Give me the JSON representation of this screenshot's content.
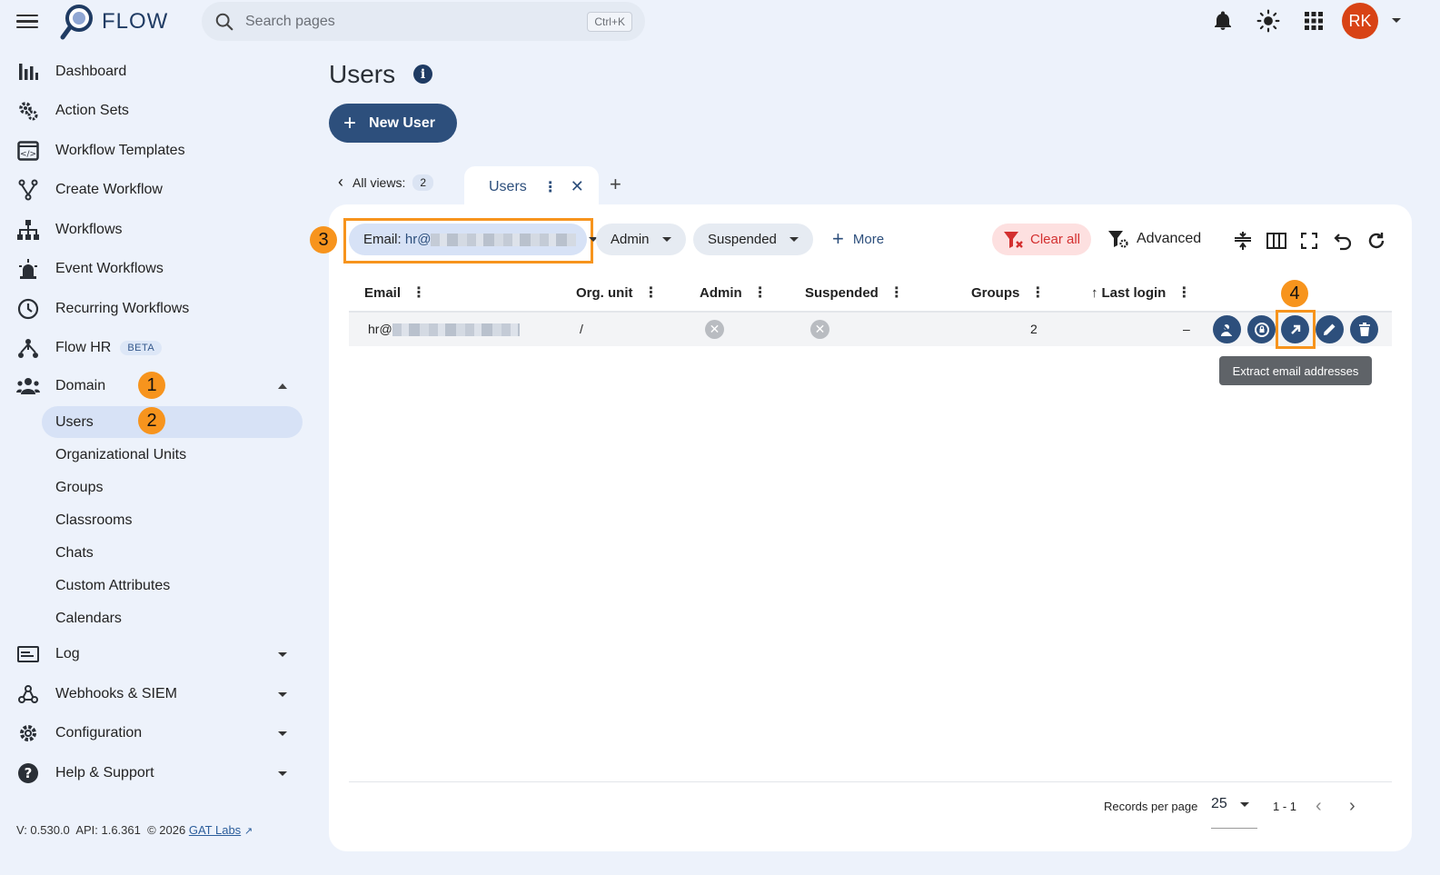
{
  "app": {
    "name": "FLOW"
  },
  "search": {
    "placeholder": "Search pages",
    "shortcut": "Ctrl+K"
  },
  "user": {
    "initials": "RK",
    "avatar_color": "#d84315"
  },
  "sidebar": {
    "items": [
      {
        "label": "Dashboard",
        "icon": "bar-chart-icon"
      },
      {
        "label": "Action Sets",
        "icon": "gears-icon"
      },
      {
        "label": "Workflow Templates",
        "icon": "template-icon"
      },
      {
        "label": "Create Workflow",
        "icon": "fork-icon"
      },
      {
        "label": "Workflows",
        "icon": "sitemap-icon"
      },
      {
        "label": "Event Workflows",
        "icon": "alarm-icon"
      },
      {
        "label": "Recurring Workflows",
        "icon": "clock-icon"
      },
      {
        "label": "Flow HR",
        "icon": "hr-icon",
        "badge": "BETA"
      },
      {
        "label": "Domain",
        "icon": "people-icon",
        "expanded": true
      }
    ],
    "domain_children": [
      "Users",
      "Organizational Units",
      "Groups",
      "Classrooms",
      "Chats",
      "Custom Attributes",
      "Calendars"
    ],
    "bottom_items": [
      {
        "label": "Log",
        "icon": "log-icon"
      },
      {
        "label": "Webhooks & SIEM",
        "icon": "webhook-icon"
      },
      {
        "label": "Configuration",
        "icon": "gear-icon"
      },
      {
        "label": "Help & Support",
        "icon": "help-icon"
      }
    ],
    "footer": {
      "version": "V: 0.530.0",
      "api": "API: 1.6.361",
      "copyright": "© 2026",
      "link": "GAT Labs"
    }
  },
  "annotations": {
    "n1": "1",
    "n2": "2",
    "n3": "3",
    "n4": "4",
    "color": "#f7941d"
  },
  "page": {
    "title": "Users",
    "new_button": "New User",
    "views_label": "All views:",
    "views_count": "2",
    "active_tab": "Users"
  },
  "filters": {
    "email_label": "Email:",
    "email_value": "hr@",
    "admin": "Admin",
    "suspended": "Suspended",
    "more": "More",
    "clear_all": "Clear all",
    "advanced": "Advanced"
  },
  "table": {
    "columns": [
      "Email",
      "Org. unit",
      "Admin",
      "Suspended",
      "Groups",
      "Last login"
    ],
    "sort_indicator": "↑",
    "rows": [
      {
        "email": "hr@",
        "org_unit": "/",
        "admin": false,
        "suspended": false,
        "groups": "2",
        "last_login": "–"
      }
    ],
    "tooltip": "Extract email addresses"
  },
  "pagination": {
    "label": "Records per page",
    "per_page": "25",
    "range": "1 - 1"
  },
  "colors": {
    "primary": "#2d4f7c",
    "danger": "#d32f2f",
    "bg": "#edf2fb"
  }
}
